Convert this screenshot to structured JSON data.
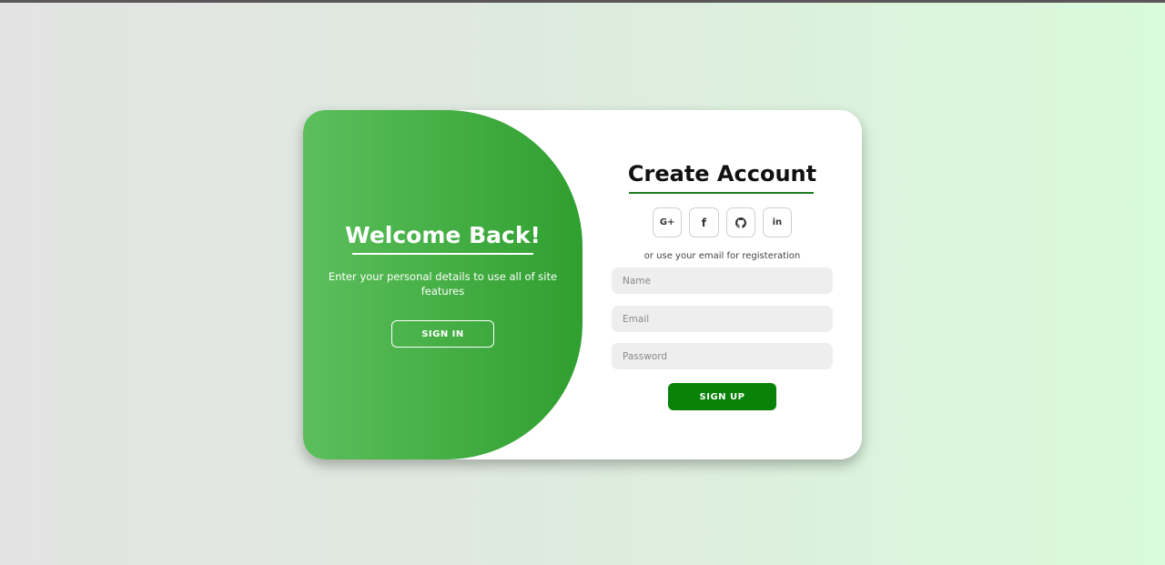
{
  "theme": {
    "accent": "#2f9f2f",
    "accent_light": "#5cbf5c",
    "button_green": "#088208",
    "background_left": "#e3e3e3",
    "background_right": "#d9fadb"
  },
  "welcome": {
    "title": "Welcome Back!",
    "text": "Enter your personal details to use all of site features",
    "signin_label": "SIGN IN"
  },
  "signup": {
    "title": "Create Account",
    "social": [
      {
        "icon": "google-plus-icon",
        "label": "G+"
      },
      {
        "icon": "facebook-icon",
        "label": "f"
      },
      {
        "icon": "github-icon",
        "label": ""
      },
      {
        "icon": "linkedin-icon",
        "label": "in"
      }
    ],
    "alt_text": "or use your email for registeration",
    "fields": {
      "name": {
        "placeholder": "Name",
        "value": ""
      },
      "email": {
        "placeholder": "Email",
        "value": ""
      },
      "password": {
        "placeholder": "Password",
        "value": ""
      }
    },
    "signup_label": "SIGN UP"
  }
}
